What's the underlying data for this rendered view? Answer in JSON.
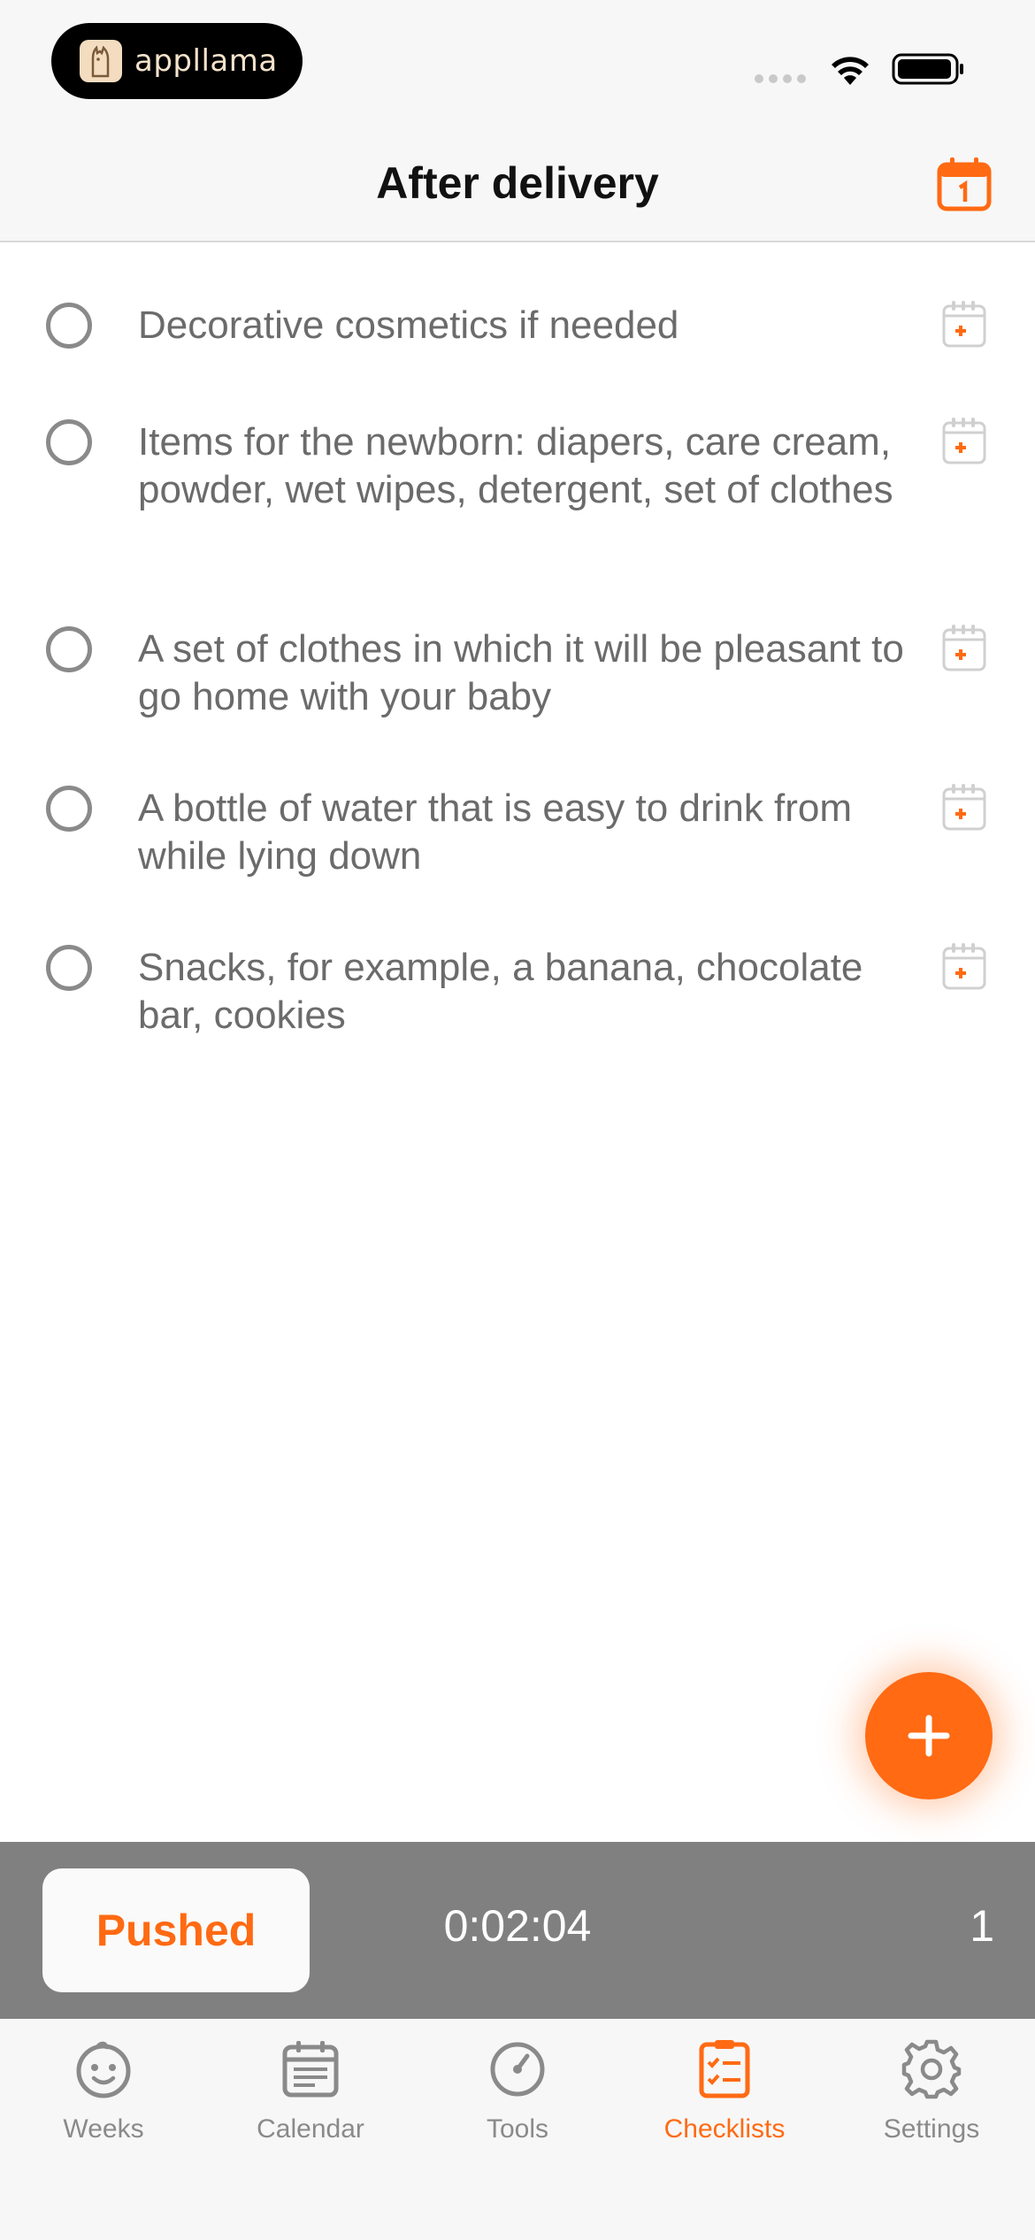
{
  "status_bar": {
    "brand": "appllama"
  },
  "header": {
    "title": "After delivery"
  },
  "checklist": {
    "items": [
      {
        "text": "Decorative cosmetics if needed",
        "checked": false
      },
      {
        "text": "Items for the newborn: diapers, care cream, powder, wet wipes, detergent, set of clothes",
        "checked": false
      },
      {
        "text": "A set of clothes in which it will be pleasant to go home with your baby",
        "checked": false
      },
      {
        "text": "A bottle of water that is easy to drink from while lying down",
        "checked": false
      },
      {
        "text": "Snacks, for example, a banana, chocolate bar, cookies",
        "checked": false
      }
    ]
  },
  "recording": {
    "button_label": "Pushed",
    "timer": "0:02:04",
    "count": "1"
  },
  "tabs": [
    {
      "label": "Weeks",
      "icon": "baby-face-icon",
      "active": false
    },
    {
      "label": "Calendar",
      "icon": "calendar-icon",
      "active": false
    },
    {
      "label": "Tools",
      "icon": "gauge-icon",
      "active": false
    },
    {
      "label": "Checklists",
      "icon": "checklist-icon",
      "active": true
    },
    {
      "label": "Settings",
      "icon": "gear-icon",
      "active": false
    }
  ],
  "colors": {
    "accent": "#ff6a13",
    "text": "#6b6b6b",
    "bar_background": "#f7f7f7",
    "recording_bar": "#808080"
  }
}
